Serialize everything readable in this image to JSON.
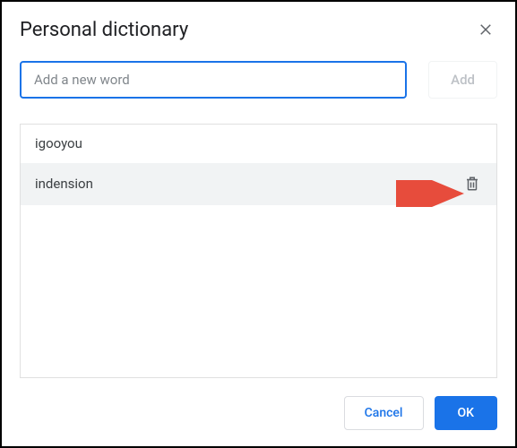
{
  "dialog": {
    "title": "Personal dictionary",
    "input_placeholder": "Add a new word",
    "add_button": "Add",
    "cancel_button": "Cancel",
    "ok_button": "OK"
  },
  "words": [
    {
      "text": "igooyou",
      "hovered": false
    },
    {
      "text": "indension",
      "hovered": true
    }
  ]
}
